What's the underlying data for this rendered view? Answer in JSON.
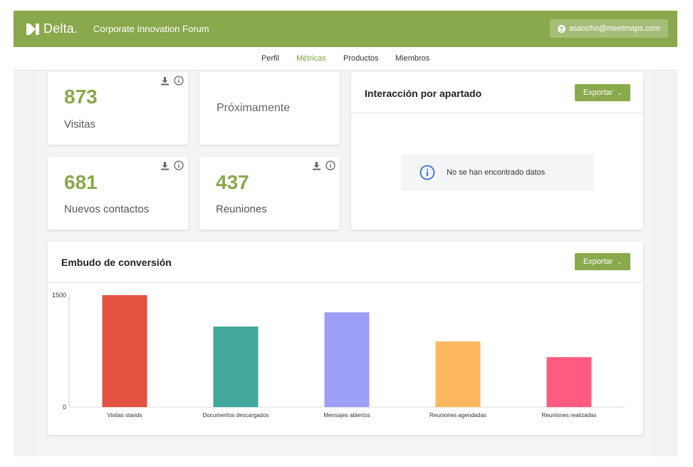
{
  "header": {
    "logo_text": "Delta.",
    "event_title": "Corporate Innovation Forum",
    "user_email": "asancho@meetmaps.com"
  },
  "subnav": {
    "tabs": [
      {
        "label": "Perfil",
        "active": false
      },
      {
        "label": "Métricas",
        "active": true
      },
      {
        "label": "Productos",
        "active": false
      },
      {
        "label": "Miembros",
        "active": false
      }
    ]
  },
  "stats": {
    "visits": {
      "value": "873",
      "label": "Visitas"
    },
    "coming_soon": {
      "label": "Próximamente"
    },
    "contacts": {
      "value": "681",
      "label": "Nuevos contactos"
    },
    "meetings": {
      "value": "437",
      "label": "Reuniones"
    }
  },
  "interaction_panel": {
    "title": "Interacción por apartado",
    "export_label": "Exportar",
    "empty_message": "No se han encontrado datos"
  },
  "funnel_panel": {
    "title": "Embudo de conversión",
    "export_label": "Exportar"
  },
  "chart_data": {
    "type": "bar",
    "categories": [
      "Visitas stands",
      "Documentos descargados",
      "Mensajes abiertos",
      "Reuniones agendadas",
      "Reuniones realizadas"
    ],
    "values": [
      1500,
      1080,
      1270,
      880,
      670
    ],
    "colors": [
      "#e35241",
      "#42a89b",
      "#9c9ef7",
      "#ffb75e",
      "#fe5b82"
    ],
    "yticks": [
      "1500",
      "0"
    ],
    "ylim": [
      0,
      1500
    ],
    "xlabel": "",
    "ylabel": "",
    "grid": false,
    "legend": false
  },
  "colors": {
    "brand": "#8aa84c",
    "brand_light": "#a6bd78",
    "info": "#3b6fd8"
  }
}
